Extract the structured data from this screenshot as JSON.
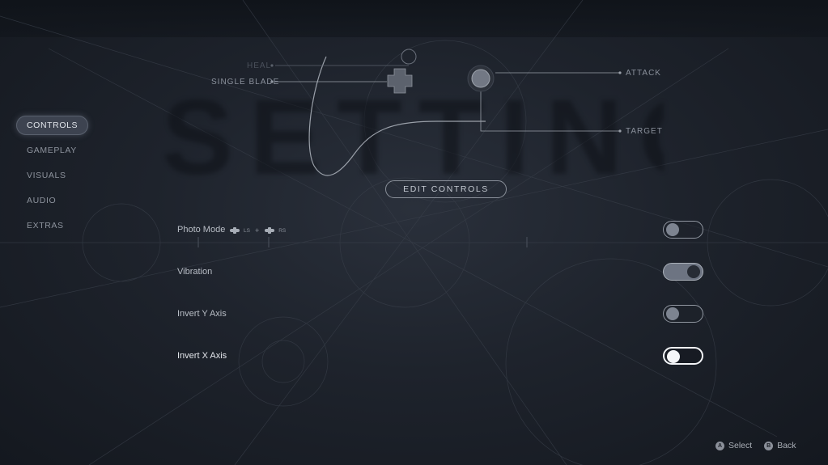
{
  "title": "SETTINGS",
  "controller_labels": {
    "heal": "HEAL",
    "single_blade": "SINGLE BLADE",
    "attack": "ATTACK",
    "target": "TARGET"
  },
  "sidebar": {
    "items": [
      {
        "label": "CONTROLS",
        "active": true
      },
      {
        "label": "GAMEPLAY",
        "active": false
      },
      {
        "label": "VISUALS",
        "active": false
      },
      {
        "label": "AUDIO",
        "active": false
      },
      {
        "label": "EXTRAS",
        "active": false
      }
    ]
  },
  "edit_controls_label": "EDIT CONTROLS",
  "settings": [
    {
      "label": "Photo Mode",
      "combo": {
        "left": "LS",
        "plus": "+",
        "right": "RS"
      },
      "enabled": false
    },
    {
      "label": "Vibration",
      "enabled": true
    },
    {
      "label": "Invert Y Axis",
      "enabled": false
    },
    {
      "label": "Invert X Axis",
      "enabled": false,
      "focused": true
    }
  ],
  "footer": {
    "select": {
      "glyph": "A",
      "label": "Select"
    },
    "back": {
      "glyph": "B",
      "label": "Back"
    }
  },
  "icons": {
    "stick": "analog-stick-icon",
    "dpad": "dpad-icon",
    "face_button": "face-button-icon"
  },
  "colors": {
    "background": "#171b23",
    "active_tab": "#3d4350",
    "toggle_on": "#6d7482",
    "focus_outline": "#f2f4f7"
  }
}
